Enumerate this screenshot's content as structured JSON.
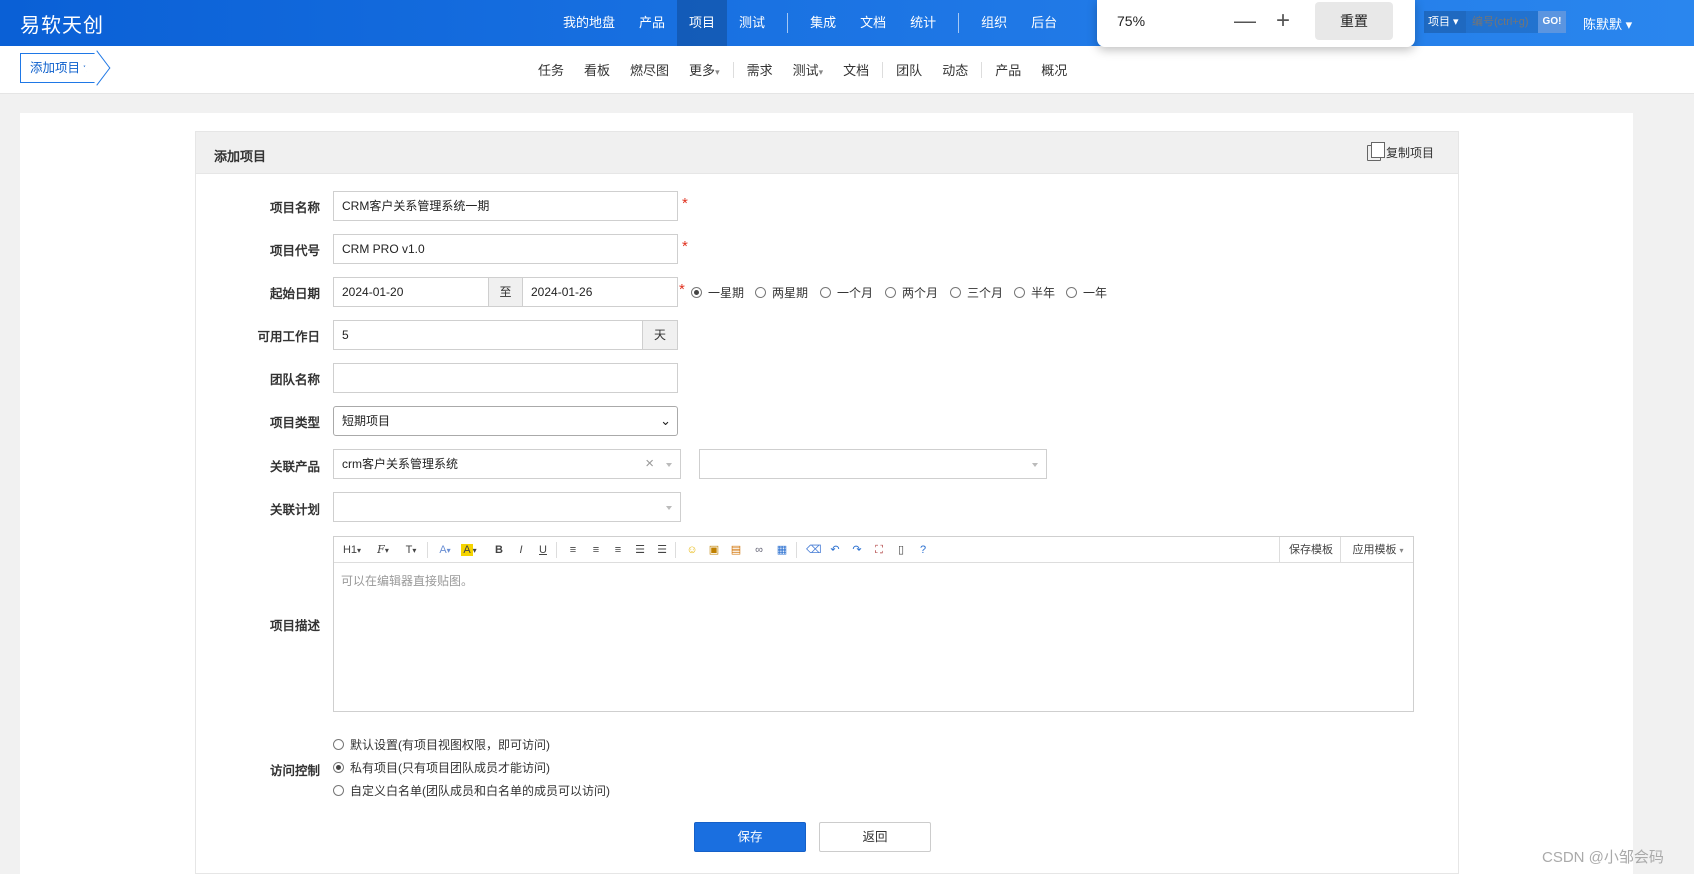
{
  "brand": "易软天创",
  "main_nav": [
    {
      "label": "我的地盘"
    },
    {
      "label": "产品"
    },
    {
      "label": "项目",
      "active": true
    },
    {
      "label": "测试"
    },
    {
      "label": "集成"
    },
    {
      "label": "文档"
    },
    {
      "label": "统计"
    },
    {
      "label": "组织"
    },
    {
      "label": "后台"
    }
  ],
  "zoom": {
    "level": "75%",
    "minus": "—",
    "plus": "+",
    "reset": "重置"
  },
  "search": {
    "type": "项目",
    "placeholder": "编号(ctrl+g)",
    "go": "GO!"
  },
  "user": "陈默默",
  "breadcrumb": {
    "label": "添加项目"
  },
  "sub_nav": [
    {
      "label": "任务"
    },
    {
      "label": "看板"
    },
    {
      "label": "燃尽图"
    },
    {
      "label": "更多"
    },
    {
      "label": "需求"
    },
    {
      "label": "测试"
    },
    {
      "label": "文档"
    },
    {
      "label": "团队"
    },
    {
      "label": "动态"
    },
    {
      "label": "产品"
    },
    {
      "label": "概况"
    }
  ],
  "panel": {
    "title": "添加项目",
    "copy": "复制项目"
  },
  "form": {
    "name": {
      "label": "项目名称",
      "value": "CRM客户关系管理系统一期"
    },
    "code": {
      "label": "项目代号",
      "value": "CRM PRO v1.0"
    },
    "dates": {
      "label": "起始日期",
      "start": "2024-01-20",
      "to": "至",
      "end": "2024-01-26"
    },
    "durations": [
      "一星期",
      "两星期",
      "一个月",
      "两个月",
      "三个月",
      "半年",
      "一年"
    ],
    "selected_duration": "一星期",
    "workdays": {
      "label": "可用工作日",
      "value": "5",
      "unit": "天"
    },
    "team": {
      "label": "团队名称",
      "value": ""
    },
    "type": {
      "label": "项目类型",
      "value": "短期项目"
    },
    "product": {
      "label": "关联产品",
      "value": "crm客户关系管理系统",
      "clear": "×",
      "second_value": ""
    },
    "plan": {
      "label": "关联计划",
      "value": ""
    },
    "desc": {
      "label": "项目描述",
      "placeholder": "可以在编辑器直接贴图。",
      "toolbar": [
        "H1",
        "F",
        "T",
        "A",
        "A",
        "B",
        "I",
        "U"
      ],
      "save_template": "保存模板",
      "apply_template": "应用模板"
    },
    "acl": {
      "label": "访问控制",
      "options": [
        "默认设置(有项目视图权限，即可访问)",
        "私有项目(只有项目团队成员才能访问)",
        "自定义白名单(团队成员和白名单的成员可以访问)"
      ],
      "selected_index": 1
    },
    "save": "保存",
    "back": "返回"
  },
  "watermark": "CSDN @小邹会码"
}
